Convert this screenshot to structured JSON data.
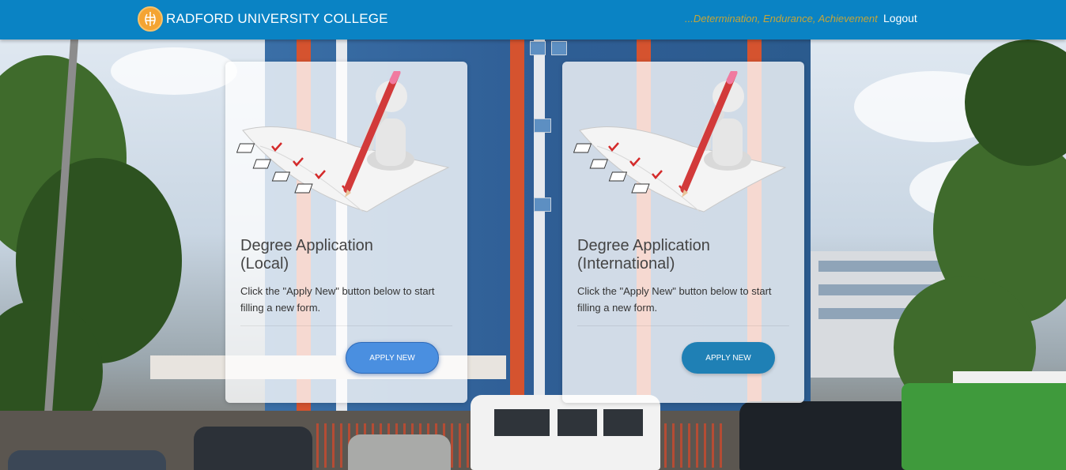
{
  "navbar": {
    "brand_name": "RADFORD UNIVERSITY COLLEGE",
    "motto": "...Determination, Endurance, Achievement",
    "logout_label": "Logout",
    "bg_color": "#0a83c4",
    "motto_color": "#c4a53a"
  },
  "cards": [
    {
      "title_line1": "Degree Application",
      "title_line2": "(Local)",
      "description": "Click the \"Apply New\" button below to start filling a new form.",
      "button_label": "APPLY NEW",
      "illustration_icon": "checklist-pencil-icon"
    },
    {
      "title_line1": "Degree Application",
      "title_line2": "(International)",
      "description": "Click the \"Apply New\" button below to start filling a new form.",
      "button_label": "APPLY NEW",
      "illustration_icon": "checklist-pencil-icon"
    }
  ]
}
